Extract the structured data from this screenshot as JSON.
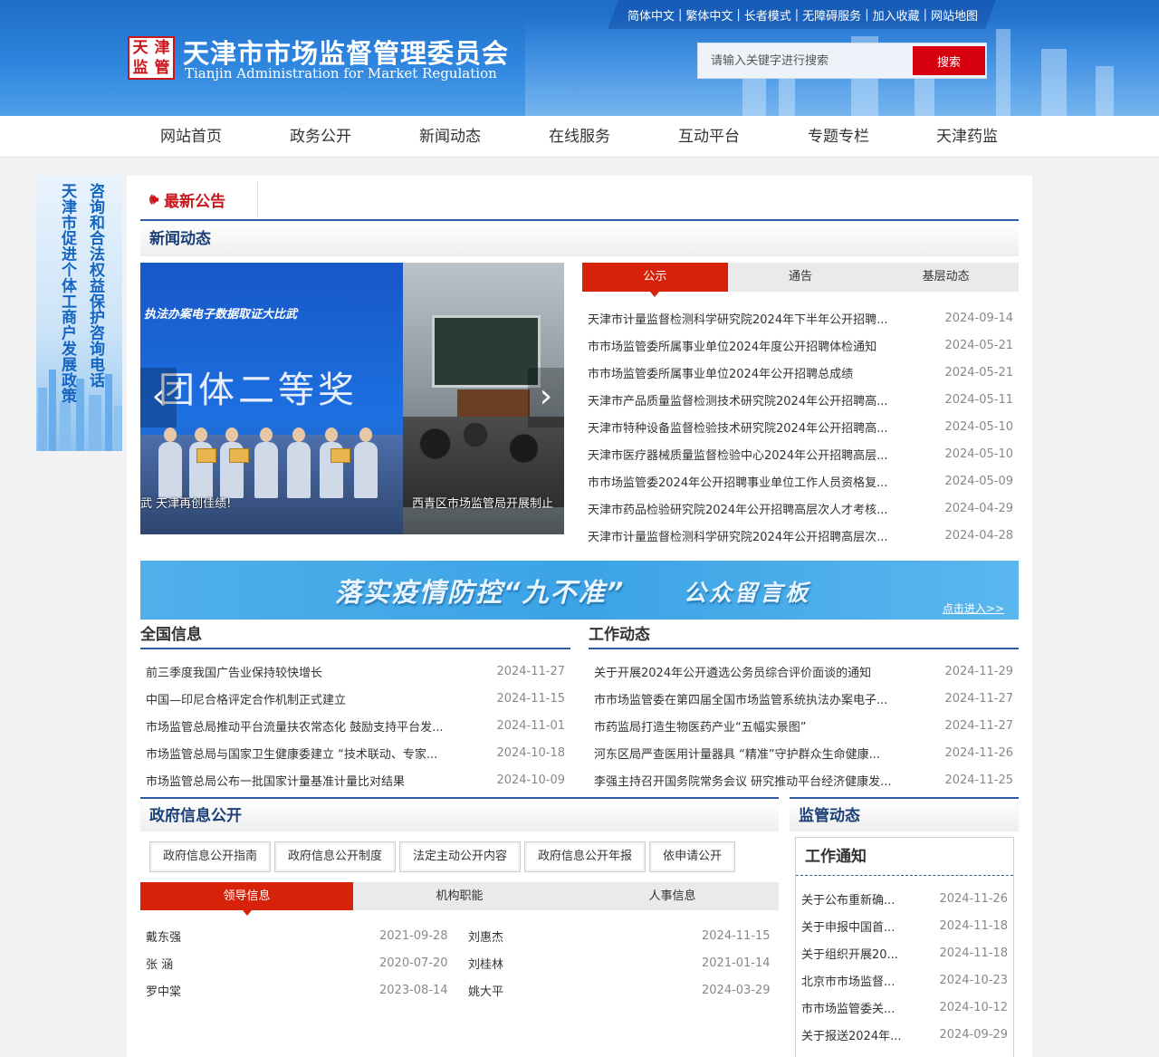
{
  "header": {
    "toplinks": [
      "简体中文",
      "繁体中文",
      "长者模式",
      "无障碍服务",
      "加入收藏",
      "网站地图"
    ],
    "seal_chars": [
      "天",
      "津",
      "监",
      "管"
    ],
    "title": "天津市市场监督管理委员会",
    "subtitle": "Tianjin Administration for Market Regulation",
    "search_placeholder": "请输入关键字进行搜索",
    "search_button": "搜索"
  },
  "nav": [
    "网站首页",
    "政务公开",
    "新闻动态",
    "在线服务",
    "互动平台",
    "专题专栏",
    "天津药监"
  ],
  "side_banner": {
    "col1": "天津市促进个体工商户发展政策",
    "col2": "咨询和合法权益保护咨询电话"
  },
  "notice": {
    "label": "最新公告"
  },
  "news_section": {
    "title": "新闻动态"
  },
  "carousel": {
    "slide1_banner": "执法办案电子数据取证大比武",
    "slide1_big": "团体二等奖",
    "caption1": "武 天津再创佳绩!",
    "caption2": "西青区市场监管局开展制止",
    "prev": "‹",
    "next": "›"
  },
  "news_tabs": {
    "tabs": [
      "公示",
      "通告",
      "基层动态"
    ],
    "items": [
      {
        "title": "天津市计量监督检测科学研究院2024年下半年公开招聘...",
        "date": "2024-09-14"
      },
      {
        "title": "市市场监管委所属事业单位2024年度公开招聘体检通知",
        "date": "2024-05-21"
      },
      {
        "title": "市市场监管委所属事业单位2024年公开招聘总成绩",
        "date": "2024-05-21"
      },
      {
        "title": "天津市产品质量监督检测技术研究院2024年公开招聘高...",
        "date": "2024-05-11"
      },
      {
        "title": "天津市特种设备监督检验技术研究院2024年公开招聘高...",
        "date": "2024-05-10"
      },
      {
        "title": "天津市医疗器械质量监督检验中心2024年公开招聘高层...",
        "date": "2024-05-10"
      },
      {
        "title": "市市场监管委2024年公开招聘事业单位工作人员资格复...",
        "date": "2024-05-09"
      },
      {
        "title": "天津市药品检验研究院2024年公开招聘高层次人才考核...",
        "date": "2024-04-29"
      },
      {
        "title": "天津市计量监督检测科学研究院2024年公开招聘高层次...",
        "date": "2024-04-28"
      }
    ]
  },
  "promo": {
    "text1": "落实疫情防控“九不准”",
    "text2": "公众留言板",
    "enter": "点击进入>>"
  },
  "national": {
    "title": "全国信息",
    "items": [
      {
        "title": "前三季度我国广告业保持较快增长",
        "date": "2024-11-27"
      },
      {
        "title": "中国—印尼合格评定合作机制正式建立",
        "date": "2024-11-15"
      },
      {
        "title": "市场监管总局推动平台流量扶农常态化 鼓励支持平台发...",
        "date": "2024-11-01"
      },
      {
        "title": "市场监管总局与国家卫生健康委建立 “技术联动、专家...",
        "date": "2024-10-18"
      },
      {
        "title": "市场监管总局公布一批国家计量基准计量比对结果",
        "date": "2024-10-09"
      }
    ]
  },
  "work": {
    "title": "工作动态",
    "items": [
      {
        "title": "关于开展2024年公开遴选公务员综合评价面谈的通知",
        "date": "2024-11-29"
      },
      {
        "title": "市市场监管委在第四届全国市场监管系统执法办案电子...",
        "date": "2024-11-27"
      },
      {
        "title": "市药监局打造生物医药产业“五幅实景图”",
        "date": "2024-11-27"
      },
      {
        "title": "河东区局严查医用计量器具 “精准”守护群众生命健康...",
        "date": "2024-11-26"
      },
      {
        "title": "李强主持召开国务院常务会议 研究推动平台经济健康发...",
        "date": "2024-11-25"
      }
    ]
  },
  "gov": {
    "title": "政府信息公开",
    "buttons": [
      "政府信息公开指南",
      "政府信息公开制度",
      "法定主动公开内容",
      "政府信息公开年报",
      "依申请公开"
    ],
    "tabs": [
      "领导信息",
      "机构职能",
      "人事信息"
    ],
    "leaders": [
      {
        "n1": "戴东强",
        "d1": "2021-09-28",
        "n2": "刘惠杰",
        "d2": "2024-11-15"
      },
      {
        "n1": "张 涵",
        "d1": "2020-07-20",
        "n2": "刘桂林",
        "d2": "2021-01-14"
      },
      {
        "n1": "罗中棠",
        "d1": "2023-08-14",
        "n2": "姚大平",
        "d2": "2024-03-29"
      }
    ]
  },
  "supervision": {
    "title": "监管动态",
    "box_title": "工作通知",
    "items": [
      {
        "title": "关于公布重新确...",
        "date": "2024-11-26"
      },
      {
        "title": "关于申报中国首...",
        "date": "2024-11-18"
      },
      {
        "title": "关于组织开展20...",
        "date": "2024-11-18"
      },
      {
        "title": "北京市市场监督...",
        "date": "2024-10-23"
      },
      {
        "title": "市市场监管委关...",
        "date": "2024-10-12"
      },
      {
        "title": "关于报送2024年...",
        "date": "2024-09-29"
      }
    ]
  },
  "colors": {
    "brand_blue": "#2f86df",
    "accent_red": "#d7220a",
    "title_blue": "#1b3f78"
  },
  "icons": {
    "notice": "speaker-icon"
  }
}
